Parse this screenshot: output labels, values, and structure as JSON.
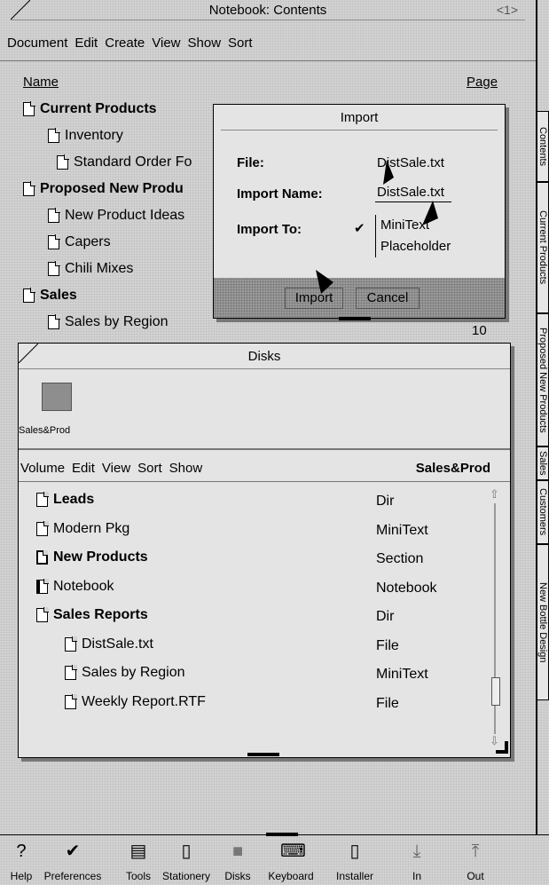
{
  "notebook": {
    "title": "Notebook: Contents",
    "page_indicator": "<1>",
    "menu": [
      "Document",
      "Edit",
      "Create",
      "View",
      "Show",
      "Sort"
    ],
    "col_name": "Name",
    "col_page": "Page",
    "items": [
      {
        "label": "Current Products",
        "bold": true,
        "indent": 0
      },
      {
        "label": "Inventory",
        "bold": false,
        "indent": 1
      },
      {
        "label": "Standard Order Fo",
        "bold": false,
        "indent": 1
      },
      {
        "label": "Proposed New Produ",
        "bold": true,
        "indent": 0
      },
      {
        "label": "New Product Ideas",
        "bold": false,
        "indent": 1
      },
      {
        "label": "Capers",
        "bold": false,
        "indent": 1
      },
      {
        "label": "Chili Mixes",
        "bold": false,
        "indent": 1
      },
      {
        "label": "Sales",
        "bold": true,
        "indent": 0
      },
      {
        "label": "Sales by Region",
        "bold": false,
        "indent": 1
      }
    ],
    "last_page": "10"
  },
  "import_dialog": {
    "title": "Import",
    "file_label": "File:",
    "file_value": "DistSale.txt",
    "import_name_label": "Import Name:",
    "import_name_value": "DistSale.txt",
    "import_to_label": "Import To:",
    "options": [
      "MiniText",
      "Placeholder"
    ],
    "selected_option": "MiniText",
    "import_button": "Import",
    "cancel_button": "Cancel"
  },
  "disks": {
    "title": "Disks",
    "volume_label": "Sales&Prod",
    "menu": [
      "Volume",
      "Edit",
      "View",
      "Sort",
      "Show"
    ],
    "current_volume": "Sales&Prod",
    "files": [
      {
        "name": "Leads",
        "type": "Dir",
        "bold": true,
        "indent": 0,
        "icon": "document-icon"
      },
      {
        "name": "Modern Pkg",
        "type": "MiniText",
        "bold": false,
        "indent": 0,
        "icon": "document-lines-icon"
      },
      {
        "name": "New Products",
        "type": "Section",
        "bold": true,
        "indent": 0,
        "icon": "section-icon"
      },
      {
        "name": "Notebook",
        "type": "Notebook",
        "bold": false,
        "indent": 0,
        "icon": "notebook-icon"
      },
      {
        "name": "Sales Reports",
        "type": "Dir",
        "bold": true,
        "indent": 0,
        "icon": "document-icon"
      },
      {
        "name": "DistSale.txt",
        "type": "File",
        "bold": false,
        "indent": 1,
        "icon": "document-icon"
      },
      {
        "name": "Sales by Region",
        "type": "MiniText",
        "bold": false,
        "indent": 1,
        "icon": "document-lines-icon"
      },
      {
        "name": "Weekly Report.RTF",
        "type": "File",
        "bold": false,
        "indent": 1,
        "icon": "document-icon"
      }
    ]
  },
  "side_tabs": [
    "Contents",
    "Current Products",
    "Proposed New Products",
    "Sales",
    "Customers",
    "New Bottle Design"
  ],
  "toolbar": [
    {
      "label": "Help",
      "icon": "help-icon",
      "glyph": "?"
    },
    {
      "label": "Preferences",
      "icon": "checkmark-icon",
      "glyph": "✔"
    },
    {
      "label": "Tools",
      "icon": "tools-icon",
      "glyph": "▤"
    },
    {
      "label": "Stationery",
      "icon": "stationery-icon",
      "glyph": "▯"
    },
    {
      "label": "Disks",
      "icon": "disks-icon",
      "glyph": "■"
    },
    {
      "label": "Keyboard",
      "icon": "keyboard-icon",
      "glyph": "⌨"
    },
    {
      "label": "Installer",
      "icon": "installer-icon",
      "glyph": "▯"
    },
    {
      "label": "In",
      "icon": "in-tray-icon",
      "glyph": "⤓"
    },
    {
      "label": "Out",
      "icon": "out-tray-icon",
      "glyph": "⤒"
    }
  ]
}
